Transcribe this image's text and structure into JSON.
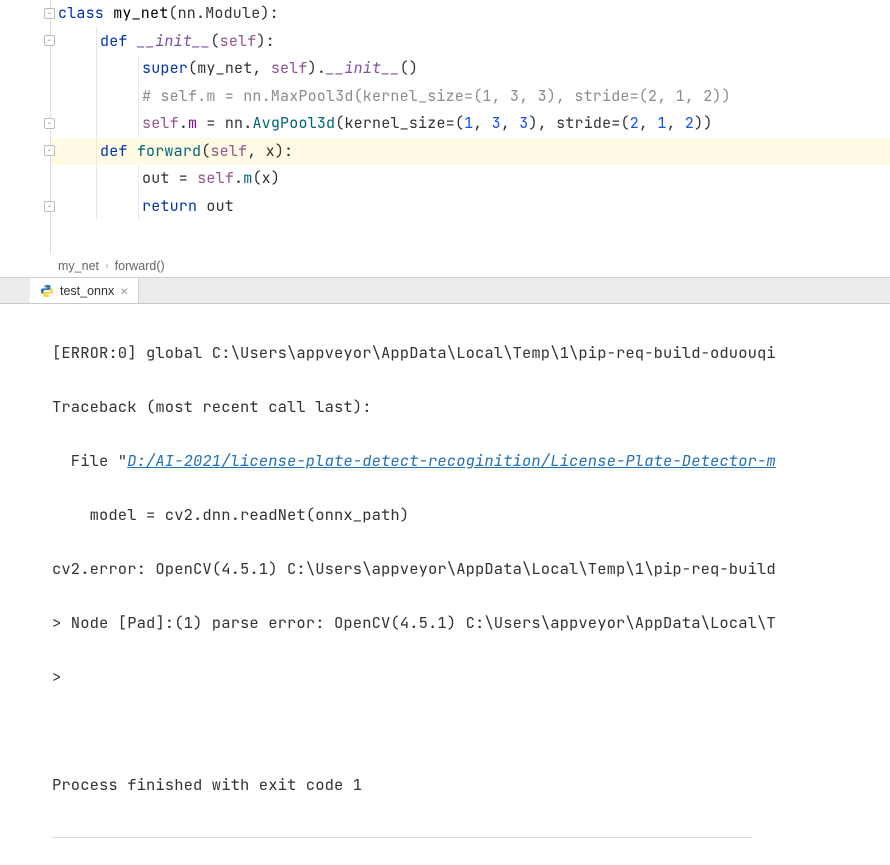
{
  "code": {
    "lines": [
      {
        "type": "class_def",
        "kw": "class ",
        "name": "my_net",
        "paren_open": "(",
        "base": "nn.Module",
        "paren_close": "):"
      },
      {
        "indent": 1,
        "kw": "def ",
        "fn": "__init__",
        "sig_open": "(",
        "self": "self",
        "sig_close": "):"
      },
      {
        "indent": 2,
        "builtin": "super",
        "paren_open": "(",
        "arg1": "my_net",
        "comma": ", ",
        "self": "self",
        "paren_close": ")",
        "dot": ".",
        "dunder": "__init__",
        "call": "()"
      },
      {
        "indent": 2,
        "comment": "# self.m = nn.MaxPool3d(kernel_size=(1, 3, 3), stride=(2, 1, 2))"
      },
      {
        "indent": 2,
        "self": "self",
        "dot1": ".",
        "attr": "m",
        "eq": " = ",
        "mod": "nn",
        "dot2": ".",
        "cls": "AvgPool3d",
        "open": "(",
        "kwarg1": "kernel_size",
        "eq1": "=",
        "tup1_open": "(",
        "n1": "1",
        "c1": ", ",
        "n2": "3",
        "c2": ", ",
        "n3": "3",
        "tup1_close": ")",
        "c3": ", ",
        "kwarg2": "stride",
        "eq2": "=",
        "tup2_open": "(",
        "n4": "2",
        "c4": ", ",
        "n5": "1",
        "c5": ", ",
        "n6": "2",
        "tup2_close": ")",
        "close": ")"
      },
      {
        "indent": 1,
        "kw": "def ",
        "fn": "forward",
        "sig_open": "(",
        "self": "self",
        "comma": ", ",
        "arg": "x",
        "sig_close": "):"
      },
      {
        "indent": 2,
        "var": "out",
        "eq": " = ",
        "self": "self",
        "dot": ".",
        "attr": "m",
        "open": "(",
        "arg": "x",
        "close": ")"
      },
      {
        "indent": 2,
        "kw": "return ",
        "var": "out"
      }
    ]
  },
  "breadcrumb": {
    "item1": "my_net",
    "item2": "forward()"
  },
  "tab": {
    "name": "test_onnx"
  },
  "console": {
    "line1": "[ERROR:0] global C:\\Users\\appveyor\\AppData\\Local\\Temp\\1\\pip-req-build-oduouqi",
    "line2": "Traceback (most recent call last):",
    "line3_prefix": "  File \"",
    "line3_link": "D:/AI-2021/license-plate-detect-recoginition/License-Plate-Detector-m",
    "line4": "    model = cv2.dnn.readNet(onnx_path)",
    "line5": "cv2.error: OpenCV(4.5.1) C:\\Users\\appveyor\\AppData\\Local\\Temp\\1\\pip-req-build",
    "line6": "> Node [Pad]:(1) parse error: OpenCV(4.5.1) C:\\Users\\appveyor\\AppData\\Local\\T",
    "line7": ">",
    "line8": "Process finished with exit code 1"
  }
}
